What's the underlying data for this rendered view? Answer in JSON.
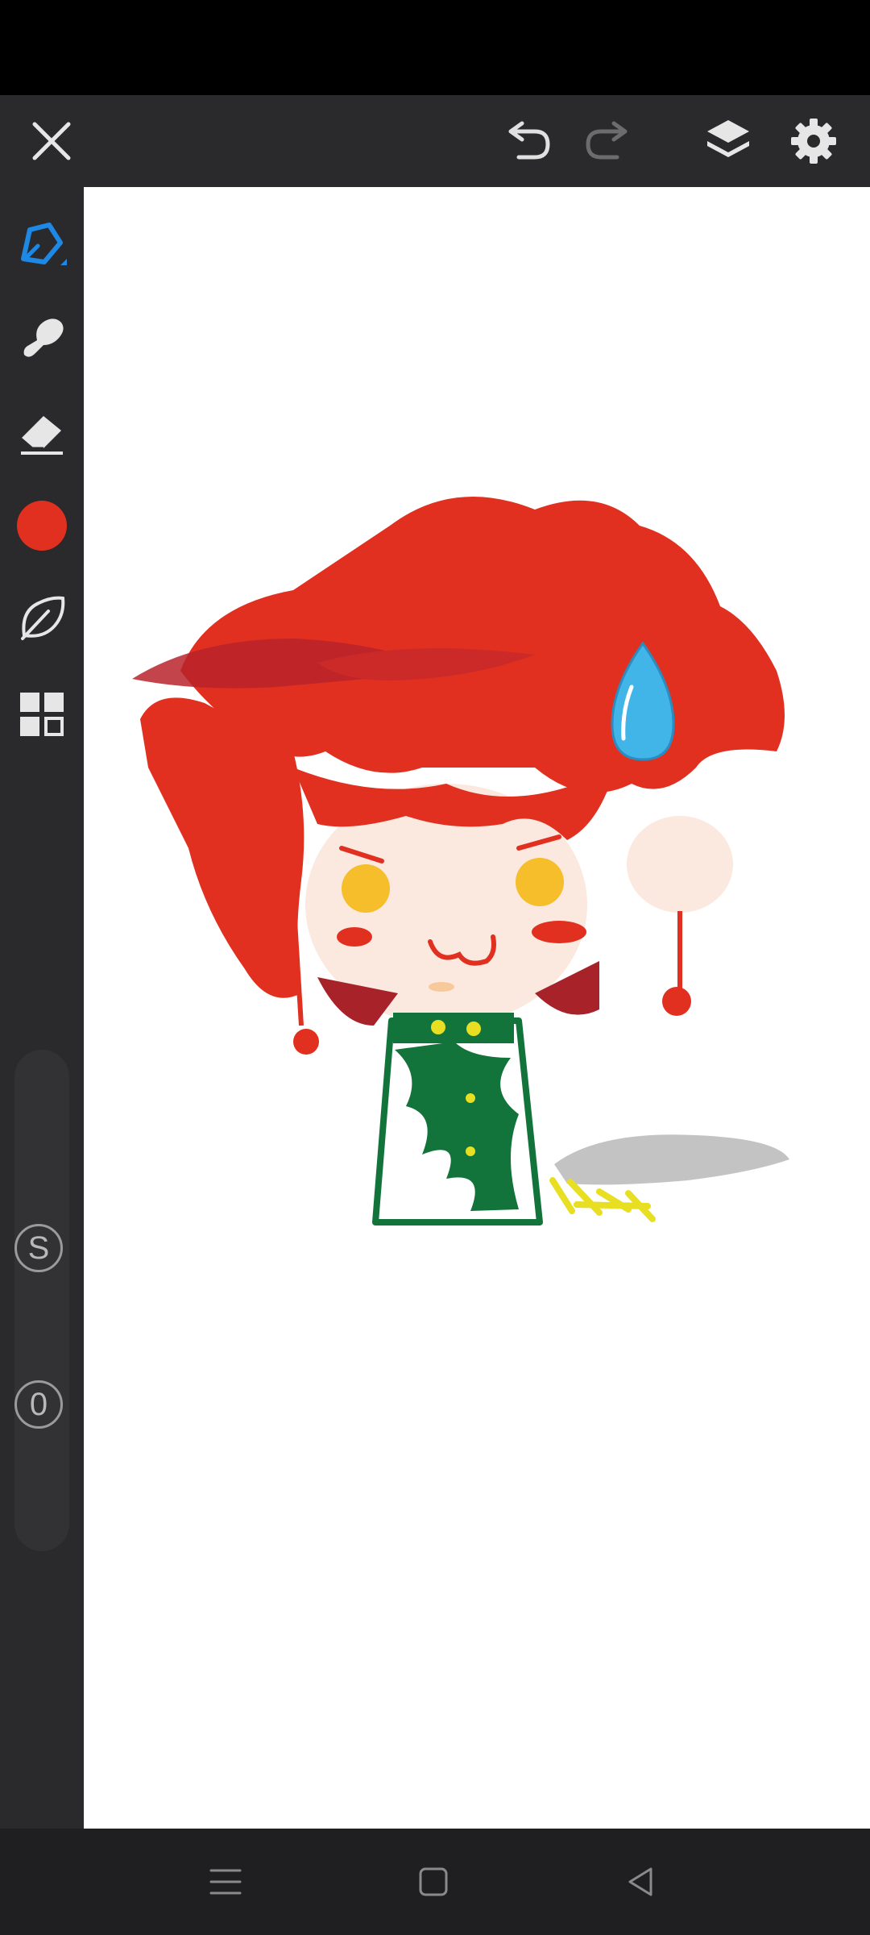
{
  "app": {
    "top_bar": {
      "close_icon": "close-icon",
      "undo_icon": "undo-icon",
      "redo_icon": "redo-icon",
      "layers_icon": "layers-icon",
      "settings_icon": "gear-icon"
    },
    "tools": [
      {
        "name": "pen-tool",
        "icon": "pen-icon",
        "active": true
      },
      {
        "name": "smudge-tool",
        "icon": "smudge-icon"
      },
      {
        "name": "eraser-tool",
        "icon": "eraser-icon"
      },
      {
        "name": "color-picker",
        "icon": "color-swatch",
        "color": "#e1301f"
      },
      {
        "name": "brush-picker",
        "icon": "leaf-icon"
      },
      {
        "name": "more-tools",
        "icon": "grid-icon"
      }
    ],
    "sliders": {
      "size_label": "S",
      "opacity_label": "0"
    },
    "navigation": {
      "menu_icon": "menu-icon",
      "home_icon": "home-icon",
      "back_icon": "back-icon"
    },
    "colors": {
      "accent": "#1e88e5",
      "hair": "#e1301f",
      "shirt": "#12743a",
      "drop": "#41b5e8",
      "eyes": "#f6be2b"
    }
  }
}
